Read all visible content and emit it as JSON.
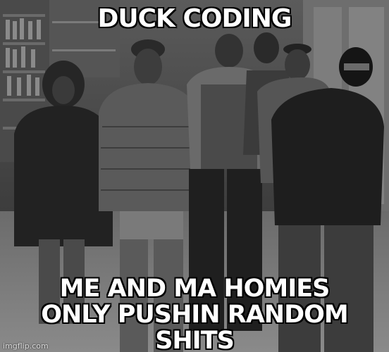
{
  "meme": {
    "top_text": "DUCK CODING",
    "bottom_line_1": "ME AND MA HOMIES",
    "bottom_line_2": "ONLY PUSHIN RANDOM SHITS",
    "watermark": "imgflip.com"
  },
  "photo": {
    "description_icon": "group-photo",
    "tone": "grayscale"
  }
}
